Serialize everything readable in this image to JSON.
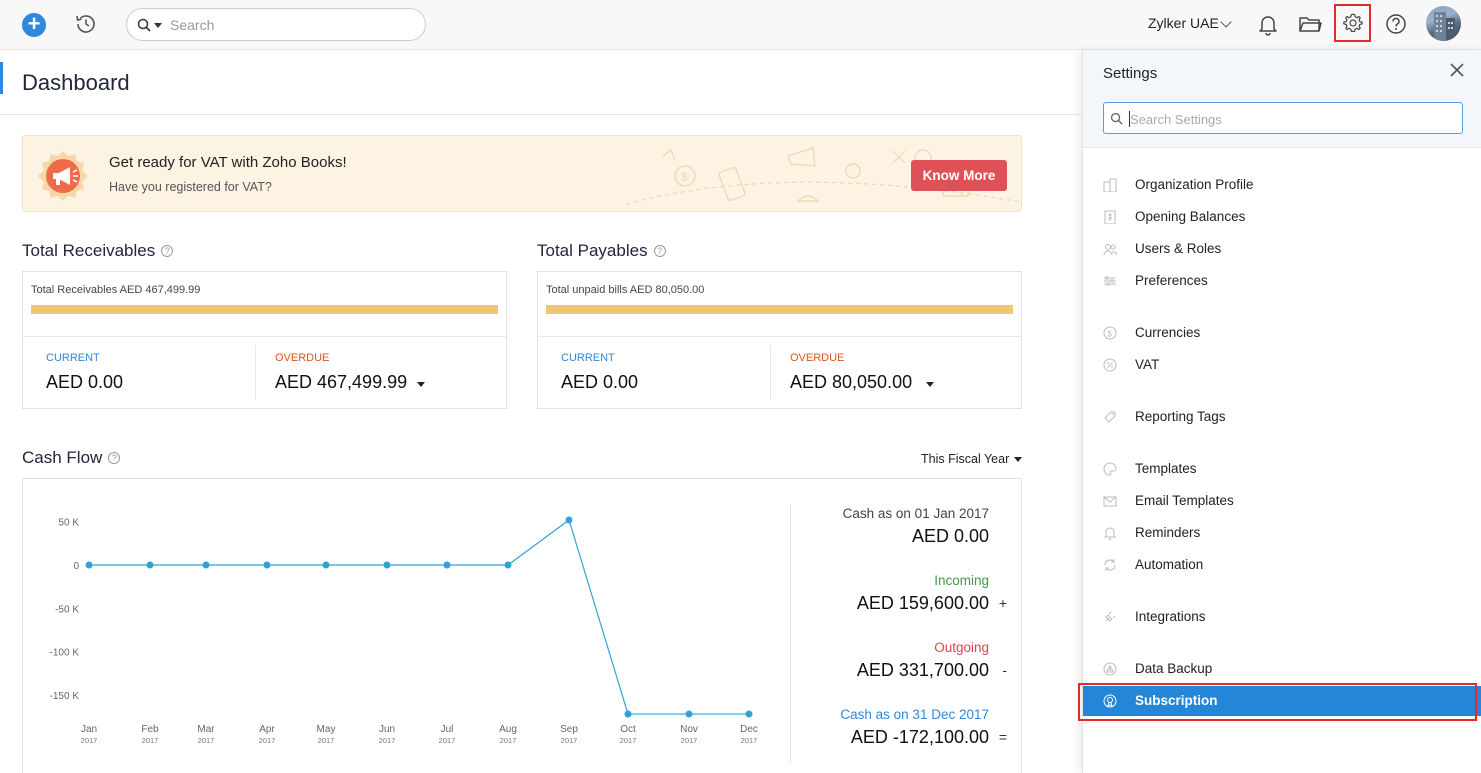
{
  "topbar": {
    "search_placeholder": "Search",
    "org_name": "Zylker UAE"
  },
  "dashboard": {
    "title": "Dashboard",
    "vat_banner": {
      "heading": "Get ready for VAT with Zoho Books!",
      "subtext": "Have you registered for VAT?",
      "button_label": "Know More"
    },
    "receivables": {
      "title": "Total Receivables",
      "caption": "Total Receivables AED 467,499.99",
      "current_label": "CURRENT",
      "current_amount": "AED 0.00",
      "overdue_label": "OVERDUE",
      "overdue_amount": "AED 467,499.99"
    },
    "payables": {
      "title": "Total Payables",
      "caption": "Total unpaid bills AED 80,050.00",
      "current_label": "CURRENT",
      "current_amount": "AED 0.00",
      "overdue_label": "OVERDUE",
      "overdue_amount": "AED 80,050.00"
    },
    "cash_flow": {
      "title": "Cash Flow",
      "period_label": "This Fiscal Year",
      "opening_label": "Cash as on 01 Jan 2017",
      "opening_amount": "AED 0.00",
      "incoming_label": "Incoming",
      "incoming_amount": "AED 159,600.00",
      "incoming_sign": "+",
      "outgoing_label": "Outgoing",
      "outgoing_amount": "AED 331,700.00",
      "outgoing_sign": "-",
      "closing_label": "Cash as on 31 Dec 2017",
      "closing_amount": "AED -172,100.00",
      "closing_sign": "="
    }
  },
  "chart_data": {
    "type": "line",
    "categories": [
      "Jan",
      "Feb",
      "Mar",
      "Apr",
      "May",
      "Jun",
      "Jul",
      "Aug",
      "Sep",
      "Oct",
      "Nov",
      "Dec"
    ],
    "category_sub": [
      "2017",
      "2017",
      "2017",
      "2017",
      "2017",
      "2017",
      "2017",
      "2017",
      "2017",
      "2017",
      "2017",
      "2017"
    ],
    "values": [
      0,
      0,
      0,
      0,
      0,
      0,
      0,
      0,
      52000,
      -172100,
      -172100,
      -172100
    ],
    "yticks": [
      50000,
      0,
      -50000,
      -100000,
      -150000
    ],
    "ytick_labels": [
      "50 K",
      "0",
      "-50 K",
      "-100 K",
      "-150 K"
    ],
    "ylim": [
      -172100,
      52000
    ],
    "grid": false,
    "color": "#2fa3d9"
  },
  "settings": {
    "title": "Settings",
    "search_placeholder": "Search Settings",
    "items": [
      {
        "label": "Organization Profile",
        "icon": "building-icon"
      },
      {
        "label": "Opening Balances",
        "icon": "ledger-icon"
      },
      {
        "label": "Users & Roles",
        "icon": "users-icon"
      },
      {
        "label": "Preferences",
        "icon": "sliders-icon"
      },
      {
        "label": "Currencies",
        "icon": "currency-icon"
      },
      {
        "label": "VAT",
        "icon": "percent-icon"
      },
      {
        "label": "Reporting Tags",
        "icon": "tag-icon"
      },
      {
        "label": "Templates",
        "icon": "palette-icon"
      },
      {
        "label": "Email Templates",
        "icon": "envelope-icon"
      },
      {
        "label": "Reminders",
        "icon": "bell-icon"
      },
      {
        "label": "Automation",
        "icon": "refresh-icon"
      },
      {
        "label": "Integrations",
        "icon": "plug-icon"
      },
      {
        "label": "Data Backup",
        "icon": "backup-icon"
      },
      {
        "label": "Subscription",
        "icon": "subscription-icon"
      }
    ]
  }
}
